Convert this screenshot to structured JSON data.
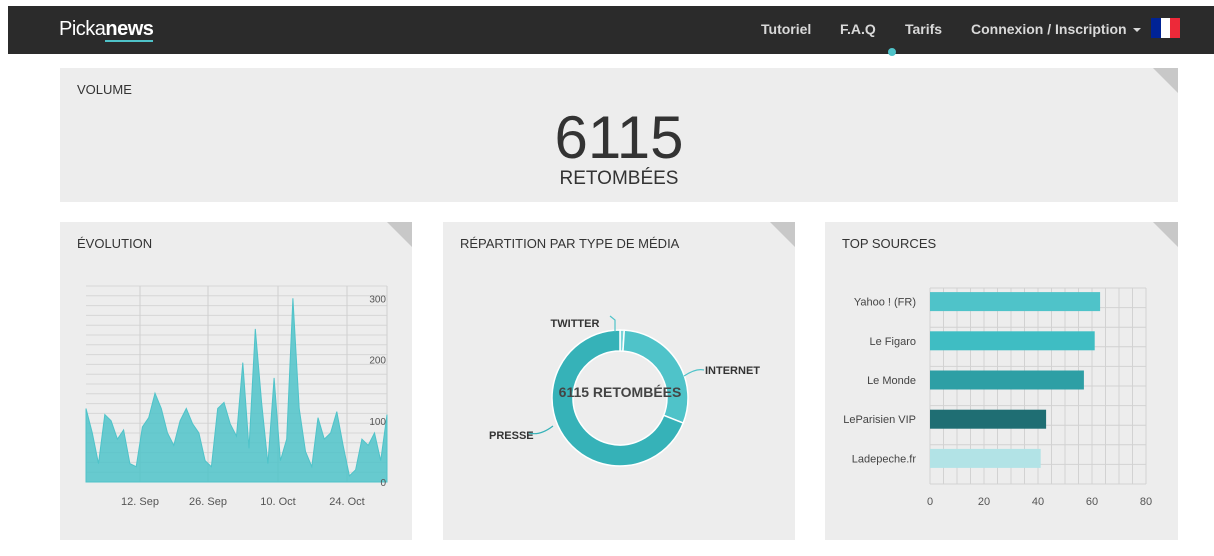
{
  "brand": {
    "part1": "Picka",
    "part2": "news"
  },
  "nav": {
    "items": [
      "Tutoriel",
      "F.A.Q",
      "Tarifs"
    ],
    "login": "Connexion / Inscription",
    "flag_colors": [
      "#002395",
      "#ffffff",
      "#ed2939"
    ]
  },
  "volume": {
    "title": "VOLUME",
    "number": "6115",
    "label": "RETOMBÉES"
  },
  "evolution": {
    "title": "ÉVOLUTION",
    "chart_data": {
      "type": "area",
      "title": "",
      "color": "#4fc3c9",
      "x_ticks": [
        "12. Sep",
        "26. Sep",
        "10. Oct",
        "24. Oct"
      ],
      "y_ticks": [
        0,
        100,
        200,
        300
      ],
      "ylim": [
        0,
        320
      ],
      "values": [
        120,
        80,
        30,
        110,
        100,
        70,
        85,
        30,
        25,
        90,
        105,
        145,
        120,
        80,
        60,
        100,
        120,
        95,
        80,
        35,
        25,
        120,
        130,
        95,
        75,
        195,
        55,
        250,
        130,
        30,
        170,
        35,
        70,
        300,
        120,
        50,
        25,
        105,
        70,
        80,
        115,
        60,
        10,
        20,
        70,
        60,
        80,
        35,
        110
      ]
    }
  },
  "media": {
    "title": "RÉPARTITION PAR TYPE DE MÉDIA",
    "center_label": "6115 RETOMBÉES",
    "chart_data": {
      "type": "pie",
      "categories": [
        "TWITTER",
        "INTERNET",
        "PRESSE"
      ],
      "values": [
        1,
        30,
        69
      ],
      "colors": [
        "#79d4d9",
        "#4fc3c9",
        "#36b2b8"
      ]
    }
  },
  "sources": {
    "title": "TOP SOURCES",
    "chart_data": {
      "type": "bar",
      "orientation": "horizontal",
      "categories": [
        "Yahoo ! (FR)",
        "Le Figaro",
        "Le Monde",
        "LeParisien VIP",
        "Ladepeche.fr"
      ],
      "values": [
        63,
        61,
        57,
        43,
        41
      ],
      "colors": [
        "#4fc3c9",
        "#3fbdc3",
        "#2e9fa5",
        "#1f6e73",
        "#b2e3e6"
      ],
      "x_ticks": [
        0,
        20,
        40,
        60,
        80
      ],
      "xlim": [
        0,
        80
      ]
    }
  }
}
